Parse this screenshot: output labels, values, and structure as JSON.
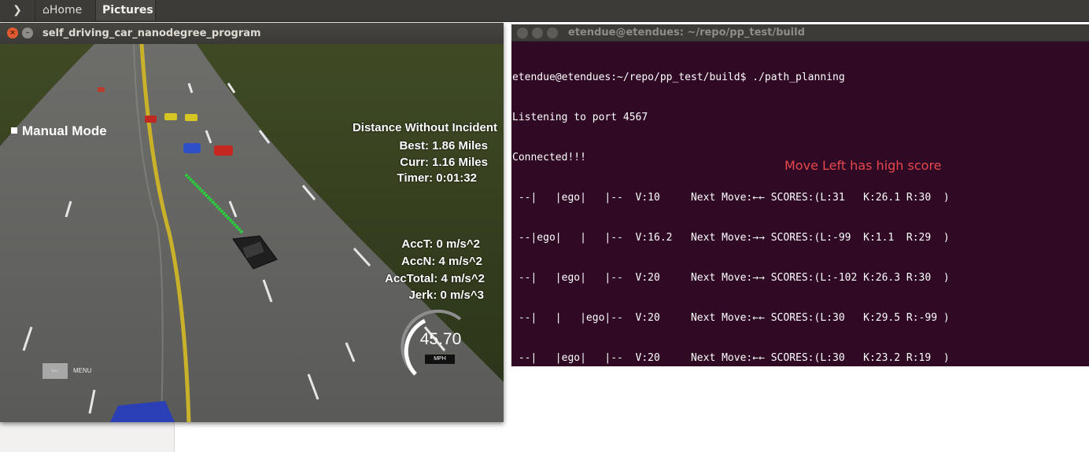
{
  "topbar": {
    "crumbs": [
      {
        "label": "Home"
      },
      {
        "label": "Pictures"
      }
    ]
  },
  "simulator": {
    "title": "self_driving_car_nanodegree_program",
    "manual_mode": "Manual Mode",
    "distance_header": "Distance Without Incident",
    "best": "Best: 1.86 Miles",
    "curr": "Curr: 1.16 Miles",
    "timer": "Timer: 0:01:32",
    "acct": "AccT: 0 m/s^2",
    "accn": "AccN: 4 m/s^2",
    "acctotal": "AccTotal: 4 m/s^2",
    "jerk": "Jerk: 0 m/s^3",
    "speed": "45.70",
    "speed_unit": "MPH",
    "speed_fraction": 0.46,
    "esc_label": "ESC",
    "menu_label": "MENU"
  },
  "terminal": {
    "title": "etendue@etendues: ~/repo/pp_test/build",
    "lines": [
      "etendue@etendues:~/repo/pp_test/build$ ./path_planning",
      "Listening to port 4567",
      "Connected!!!",
      " --|   |ego|   |--  V:10     Next Move:←← SCORES:(L:31   K:26.1 R:30  )",
      " --|ego|   |   |--  V:16.2   Next Move:→→ SCORES:(L:-99  K:1.1  R:29  )",
      " --|   |ego|   |--  V:20     Next Move:→→ SCORES:(L:-102 K:26.3 R:30  )",
      " --|   |   |ego|--  V:20     Next Move:←← SCORES:(L:30   K:29.5 R:-99 )",
      " --|   |ego|   |--  V:20     Next Move:←← SCORES:(L:30   K:23.2 R:19  )"
    ],
    "annotation": "Move Left has high score"
  }
}
